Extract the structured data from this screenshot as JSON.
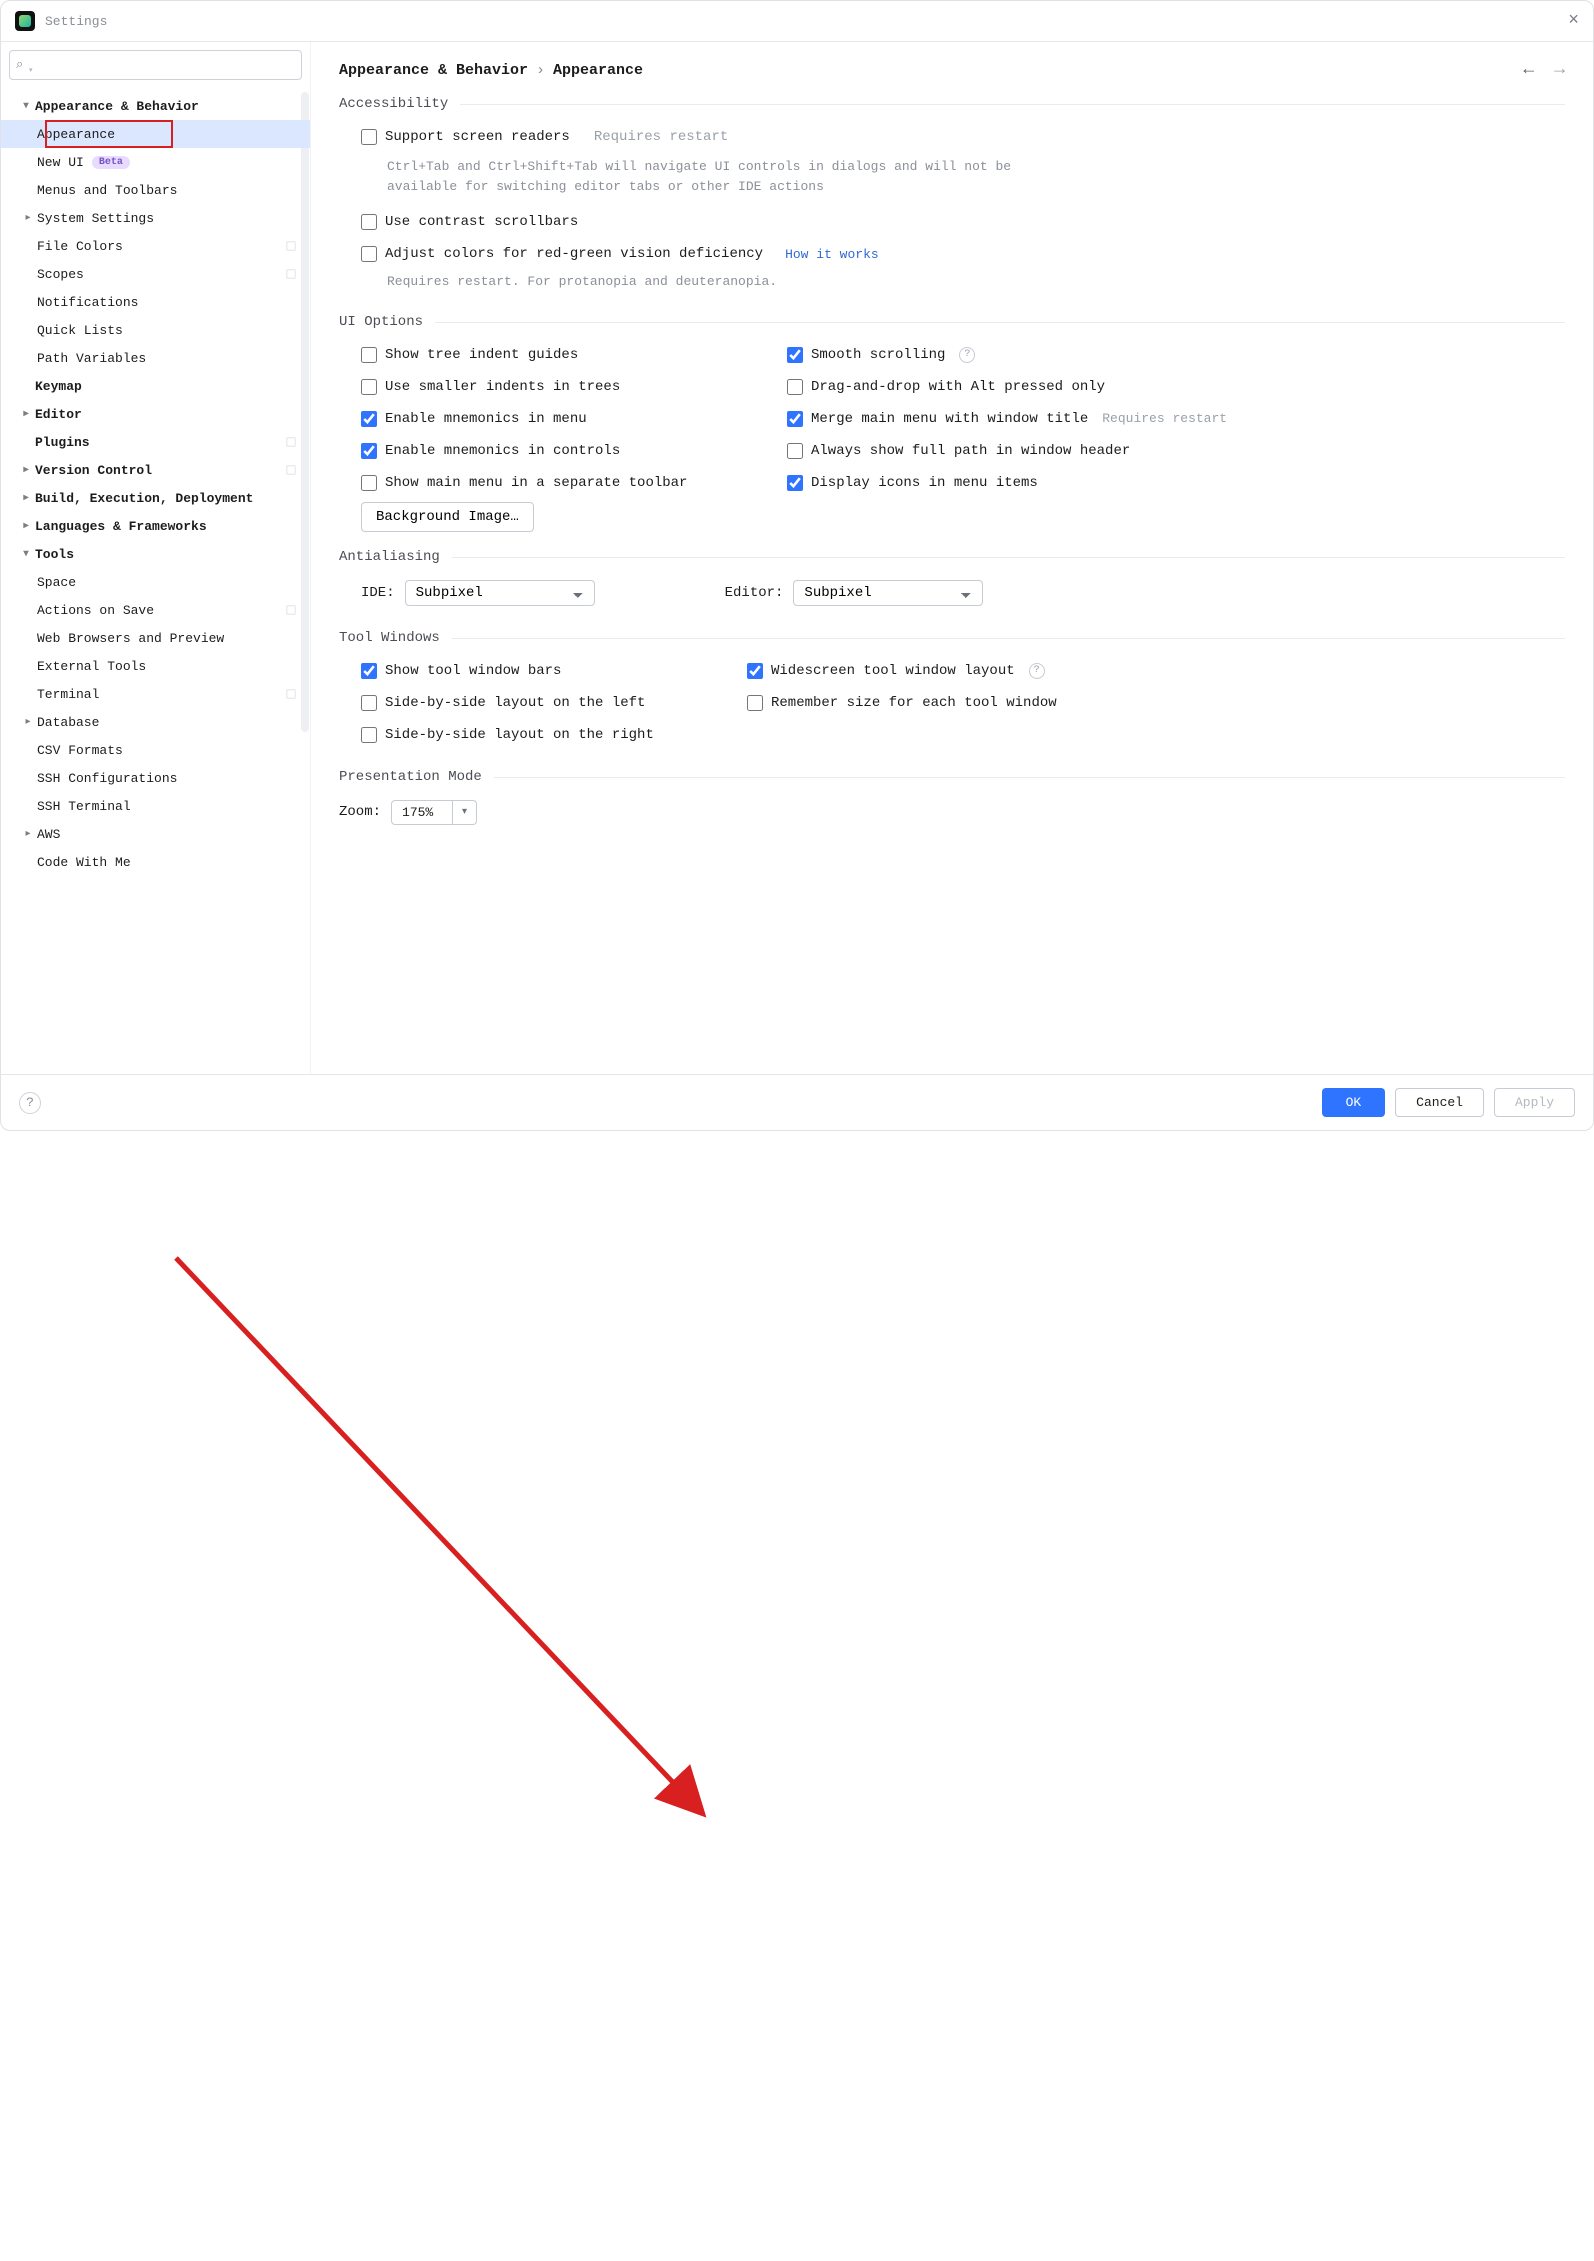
{
  "window": {
    "title": "Settings"
  },
  "breadcrumb": {
    "root": "Appearance & Behavior",
    "leaf": "Appearance"
  },
  "sidebar": {
    "search_placeholder": "",
    "items": [
      {
        "label": "Appearance & Behavior",
        "depth": 0,
        "chev": "down",
        "bold": true
      },
      {
        "label": "Appearance",
        "depth": 1,
        "selected": true,
        "outlined": true
      },
      {
        "label": "New UI",
        "depth": 1,
        "badge": "Beta"
      },
      {
        "label": "Menus and Toolbars",
        "depth": 1
      },
      {
        "label": "System Settings",
        "depth": 1,
        "chev": "right"
      },
      {
        "label": "File Colors",
        "depth": 1,
        "diamond": true
      },
      {
        "label": "Scopes",
        "depth": 1,
        "diamond": true
      },
      {
        "label": "Notifications",
        "depth": 1
      },
      {
        "label": "Quick Lists",
        "depth": 1
      },
      {
        "label": "Path Variables",
        "depth": 1
      },
      {
        "label": "Keymap",
        "depth": 0,
        "bold": true
      },
      {
        "label": "Editor",
        "depth": 0,
        "chev": "right",
        "bold": true
      },
      {
        "label": "Plugins",
        "depth": 0,
        "bold": true,
        "diamond": true
      },
      {
        "label": "Version Control",
        "depth": 0,
        "chev": "right",
        "bold": true,
        "diamond": true
      },
      {
        "label": "Build, Execution, Deployment",
        "depth": 0,
        "chev": "right",
        "bold": true
      },
      {
        "label": "Languages & Frameworks",
        "depth": 0,
        "chev": "right",
        "bold": true
      },
      {
        "label": "Tools",
        "depth": 0,
        "chev": "down",
        "bold": true
      },
      {
        "label": "Space",
        "depth": 1
      },
      {
        "label": "Actions on Save",
        "depth": 1,
        "diamond": true
      },
      {
        "label": "Web Browsers and Preview",
        "depth": 1
      },
      {
        "label": "External Tools",
        "depth": 1
      },
      {
        "label": "Terminal",
        "depth": 1,
        "diamond": true
      },
      {
        "label": "Database",
        "depth": 1,
        "chev": "right"
      },
      {
        "label": "CSV Formats",
        "depth": 1
      },
      {
        "label": "SSH Configurations",
        "depth": 1
      },
      {
        "label": "SSH Terminal",
        "depth": 1
      },
      {
        "label": "AWS",
        "depth": 1,
        "chev": "right"
      },
      {
        "label": "Code With Me",
        "depth": 1
      }
    ]
  },
  "sections": {
    "accessibility": {
      "title": "Accessibility",
      "screen_readers": {
        "label": "Support screen readers",
        "hint_inline": "Requires restart",
        "desc": "Ctrl+Tab and Ctrl+Shift+Tab will navigate UI controls in dialogs and will not be available for switching editor tabs or other IDE actions"
      },
      "contrast_sb": {
        "label": "Use contrast scrollbars"
      },
      "rg_deficiency": {
        "label": "Adjust colors for red-green vision deficiency",
        "link": "How it works",
        "desc": "Requires restart. For protanopia and deuteranopia."
      }
    },
    "ui_options": {
      "title": "UI Options",
      "tree_indent": {
        "label": "Show tree indent guides",
        "checked": false
      },
      "smooth_scroll": {
        "label": "Smooth scrolling",
        "checked": true,
        "help": true
      },
      "smaller_indents": {
        "label": "Use smaller indents in trees",
        "checked": false
      },
      "dnd_alt": {
        "label": "Drag-and-drop with Alt pressed only",
        "checked": false
      },
      "mnemonics_menu": {
        "label": "Enable mnemonics in menu",
        "checked": true
      },
      "merge_menu_title": {
        "label": "Merge main menu with window title",
        "checked": true,
        "hint": "Requires restart"
      },
      "mnemonics_ctrls": {
        "label": "Enable mnemonics in controls",
        "checked": true
      },
      "full_path_header": {
        "label": "Always show full path in window header",
        "checked": false
      },
      "main_menu_toolbar": {
        "label": "Show main menu in a separate toolbar",
        "checked": false
      },
      "icons_in_menu": {
        "label": "Display icons in menu items",
        "checked": true
      },
      "bg_image_btn": "Background Image…"
    },
    "antialiasing": {
      "title": "Antialiasing",
      "ide_label": "IDE:",
      "ide_value": "Subpixel",
      "editor_label": "Editor:",
      "editor_value": "Subpixel"
    },
    "tool_windows": {
      "title": "Tool Windows",
      "show_bars": {
        "label": "Show tool window bars",
        "checked": true
      },
      "widescreen": {
        "label": "Widescreen tool window layout",
        "checked": true,
        "help": true
      },
      "sbs_left": {
        "label": "Side-by-side layout on the left",
        "checked": false
      },
      "remember_size": {
        "label": "Remember size for each tool window",
        "checked": false
      },
      "sbs_right": {
        "label": "Side-by-side layout on the right",
        "checked": false
      }
    },
    "presentation": {
      "title": "Presentation Mode",
      "zoom_label": "Zoom:",
      "zoom_value": "175%"
    }
  },
  "footer": {
    "ok": "OK",
    "cancel": "Cancel",
    "apply": "Apply"
  }
}
